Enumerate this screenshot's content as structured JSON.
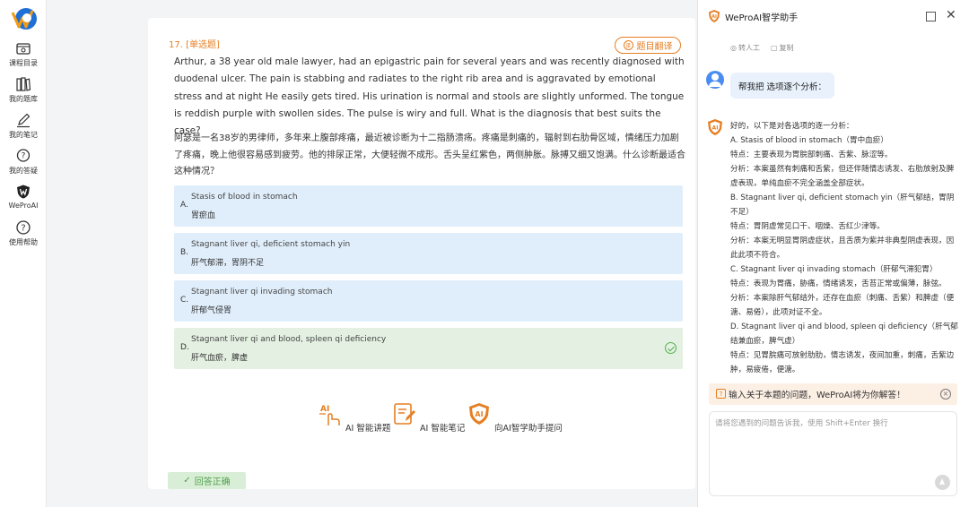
{
  "nav": {
    "items": [
      {
        "label": "课程目录",
        "icon": "folder-search-icon"
      },
      {
        "label": "我的题库",
        "icon": "books-icon"
      },
      {
        "label": "我的笔记",
        "icon": "pen-icon"
      },
      {
        "label": "我的答疑",
        "icon": "question-chat-icon"
      },
      {
        "label": "WeProAI",
        "icon": "weproai-shield-icon"
      },
      {
        "label": "使用帮助",
        "icon": "help-icon"
      }
    ]
  },
  "question": {
    "number": "17. [单选题]",
    "translate_label": "题目翻译",
    "text_en": "Arthur, a 38 year old male lawyer, had an epigastric pain for several years and was recently diagnosed with duodenal ulcer. The pain is stabbing and radiates to the right rib area and is aggravated by emotional stress and at night He easily gets tired. His urination is normal and stools are slightly unformed. The tongue is reddish purple with swollen sides. The pulse is wiry and full. What is the diagnosis that best suits the case?",
    "text_cn": "阿瑟是一名38岁的男律师，多年来上腹部疼痛，最近被诊断为十二指肠溃疡。疼痛是刺痛的，辐射到右肋骨区域，情绪压力加剧了疼痛，晚上他很容易感到疲劳。他的排尿正常，大便轻微不成形。舌头呈红紫色，两侧肿胀。脉搏又细又饱满。什么诊断最适合这种情况？",
    "options": [
      {
        "letter": "A.",
        "en": "Stasis of blood in stomach",
        "cn": "胃瘀血"
      },
      {
        "letter": "B.",
        "en": "Stagnant liver qi, deficient stomach yin",
        "cn": "肝气郁滞，胃阴不足"
      },
      {
        "letter": "C.",
        "en": "Stagnant liver qi invading stomach",
        "cn": "肝郁气侵胃"
      },
      {
        "letter": "D.",
        "en": "Stagnant liver qi and blood, spleen qi deficiency",
        "cn": "肝气血瘀，脾虚"
      }
    ]
  },
  "tools": {
    "lecture": "AI 智能讲题",
    "notes": "AI 智能笔记",
    "ask": "向AI智学助手提问"
  },
  "answer_status": "回答正确",
  "panel": {
    "title": "WeProAI智学助手",
    "actions": [
      "转人工",
      "复制"
    ],
    "user_message": "帮我把 选项逐个分析：",
    "ai_lines": [
      "好的，以下是对各选项的逐一分析：",
      "A. Stasis of blood in stomach（胃中血瘀）",
      "特点：主要表现为胃脘部刺痛、舌紫、脉涩等。",
      "分析：本案虽然有刺痛和舌紫，但还伴随情志诱发、右肋放射及脾虚表现，单纯血瘀不完全涵盖全部症状。",
      "B. Stagnant liver qi, deficient stomach yin（肝气郁结，胃阴不足）",
      "特点：胃阴虚常见口干、咽燥、舌红少津等。",
      "分析：本案无明显胃阴虚症状，且舌质为紫并非典型阴虚表现，因此此项不符合。",
      "C. Stagnant liver qi invading stomach（肝郁气滞犯胃）",
      "特点：表现为胃痛，胁痛，情绪诱发，舌苔正常或偏薄，脉弦。",
      "分析：本案除肝气郁结外，还存在血瘀（刺痛、舌紫）和脾虚（便溏、易倦），此项对证不全。",
      "D. Stagnant liver qi and blood, spleen qi deficiency（肝气郁结兼血瘀，脾气虚）",
      "特点：见胃脘痛可放射肋肋，情志诱发，夜间加重，刺痛，舌紫边肿，易疲倦，便溏。"
    ],
    "hint": "输入关于本题的问题，WeProAI将为你解答！",
    "input_placeholder": "请将您遇到的问题告诉我，使用 Shift+Enter 换行"
  },
  "colors": {
    "accent": "#e67e22",
    "option_bg": "#e0eefb",
    "correct_bg": "#e4f1e2",
    "correct": "#52b04f"
  }
}
